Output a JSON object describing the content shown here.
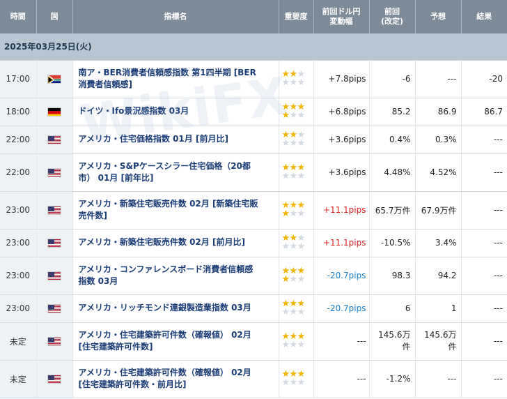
{
  "header": {
    "time": "時間",
    "country": "国",
    "indicator": "指標名",
    "importance": "重要度",
    "move_line1": "前回ドル円",
    "move_line2": "変動幅",
    "prev_line1": "前回",
    "prev_line2": "(改定)",
    "forecast": "予想",
    "result": "結果"
  },
  "date_label": "2025年03月25日(火)",
  "watermark": "WikiFX",
  "rows": [
    {
      "time": "17:00",
      "country_icon": "south-africa-flag-icon",
      "name_l1": "南ア・BER消費者信頼感指数 第1四半期 [BER",
      "name_l2": "消費者信頼感]",
      "stars": 2,
      "pips": "+7.8pips",
      "pip_color": "default",
      "prev": "-6",
      "forecast": "---",
      "result": "-20"
    },
    {
      "time": "18:00",
      "country_icon": "germany-flag-icon",
      "name_l1": "ドイツ・Ifo景況感指数 03月",
      "name_l2": "",
      "stars": 4,
      "pips": "+6.8pips",
      "pip_color": "default",
      "prev": "85.2",
      "forecast": "86.9",
      "result": "86.7"
    },
    {
      "time": "22:00",
      "country_icon": "usa-flag-icon",
      "name_l1": "アメリカ・住宅価格指数 01月 [前月比]",
      "name_l2": "",
      "stars": 2,
      "pips": "+3.6pips",
      "pip_color": "default",
      "prev": "0.4%",
      "forecast": "0.3%",
      "result": "---"
    },
    {
      "time": "22:00",
      "country_icon": "usa-flag-icon",
      "name_l1": "アメリカ・S&Pケースシラー住宅価格（20都",
      "name_l2": "市） 01月 [前年比]",
      "stars": 3,
      "pips": "+3.6pips",
      "pip_color": "default",
      "prev": "4.48%",
      "forecast": "4.52%",
      "result": "---"
    },
    {
      "time": "23:00",
      "country_icon": "usa-flag-icon",
      "name_l1": "アメリカ・新築住宅販売件数 02月 [新築住宅販",
      "name_l2": "売件数]",
      "stars": 4,
      "pips": "+11.1pips",
      "pip_color": "red",
      "prev": "65.7万件",
      "forecast": "67.9万件",
      "result": "---"
    },
    {
      "time": "23:00",
      "country_icon": "usa-flag-icon",
      "name_l1": "アメリカ・新築住宅販売件数 02月 [前月比]",
      "name_l2": "",
      "stars": 2,
      "pips": "+11.1pips",
      "pip_color": "red",
      "prev": "-10.5%",
      "forecast": "3.4%",
      "result": "---"
    },
    {
      "time": "23:00",
      "country_icon": "usa-flag-icon",
      "name_l1": "アメリカ・コンファレンスボード消費者信頼感",
      "name_l2": "指数 03月",
      "stars": 4,
      "pips": "-20.7pips",
      "pip_color": "blue",
      "prev": "98.3",
      "forecast": "94.2",
      "result": "---"
    },
    {
      "time": "23:00",
      "country_icon": "usa-flag-icon",
      "name_l1": "アメリカ・リッチモンド連銀製造業指数 03月",
      "name_l2": "",
      "stars": 3,
      "pips": "-20.7pips",
      "pip_color": "blue",
      "prev": "6",
      "forecast": "1",
      "result": "---"
    },
    {
      "time": "未定",
      "country_icon": "usa-flag-icon",
      "name_l1": "アメリカ・住宅建築許可件数（確報値） 02月",
      "name_l2": "[住宅建築許可件数]",
      "stars": 3,
      "pips": "---",
      "pip_color": "default",
      "prev_l1": "145.6万",
      "prev_l2": "件",
      "forecast_l1": "145.6万",
      "forecast_l2": "件",
      "result": "---"
    },
    {
      "time": "未定",
      "country_icon": "usa-flag-icon",
      "name_l1": "アメリカ・住宅建築許可件数（確報値） 02月",
      "name_l2": "[住宅建築許可件数・前月比]",
      "stars": 3,
      "pips": "---",
      "pip_color": "default",
      "prev": "-1.2%",
      "forecast": "---",
      "result": "---"
    }
  ],
  "colors": {
    "header_bg": "#7d8b98",
    "date_bg": "#b8c6d1",
    "star_on": "#f0b400",
    "star_off": "#d3dae1",
    "pip_red": "#d61f1f",
    "pip_blue": "#1a7fd0",
    "name_text": "#1a3c77"
  }
}
